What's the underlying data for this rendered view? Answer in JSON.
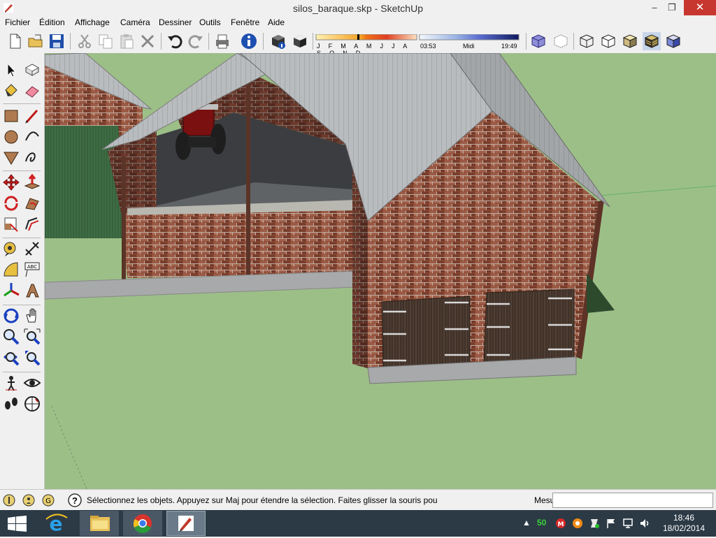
{
  "window": {
    "title": "silos_baraque.skp - SketchUp",
    "min_glyph": "–",
    "max_glyph": "❐",
    "close_glyph": "✕"
  },
  "menu": [
    "Fichier",
    "Édition",
    "Affichage",
    "Caméra",
    "Dessiner",
    "Outils",
    "Fenêtre",
    "Aide"
  ],
  "shadows": {
    "months": "J F M A M J J A S O N D",
    "time_start": "03:53",
    "time_mid": "Midi",
    "time_end": "19:49"
  },
  "status": {
    "message": "Sélectionnez les objets. Appuyez sur Maj pour étendre la sélection. Faites glisser la souris pou",
    "measures_label": "Mesures",
    "measures_value": "",
    "help_glyph": "?"
  },
  "taskbar": {
    "tray_count": "50",
    "time": "18:46",
    "date": "18/02/2014"
  },
  "colors": {
    "ground": "#9cbf88",
    "brick": "#8a4a36",
    "roof": "#b9bcbf",
    "door": "#4a3a30",
    "close_red": "#c7372f",
    "taskbar": "#2c3a46"
  },
  "icons": {
    "toolbar": [
      "new-icon",
      "open-icon",
      "save-icon",
      "cut-icon",
      "copy-icon",
      "paste-icon",
      "erase-icon",
      "undo-icon",
      "redo-icon",
      "print-icon",
      "model-info-icon",
      "shadow-settings-icon",
      "shadow-toggle-icon",
      "xray-icon",
      "wireframe-icon",
      "hidden-line-icon",
      "shaded-icon",
      "shaded-texture-icon",
      "monochrome-icon"
    ],
    "tools": [
      "select-icon",
      "make-component-icon",
      "paint-bucket-icon",
      "eraser-icon",
      "rectangle-icon",
      "line-icon",
      "circle-icon",
      "arc-icon",
      "polygon-icon",
      "freehand-icon",
      "move-icon",
      "push-pull-icon",
      "rotate-icon",
      "follow-me-icon",
      "scale-icon",
      "offset-icon",
      "tape-measure-icon",
      "dimension-icon",
      "protractor-icon",
      "text-icon",
      "axes-icon",
      "3d-text-icon",
      "orbit-icon",
      "pan-icon",
      "zoom-icon",
      "zoom-window-icon",
      "zoom-extents-icon",
      "previous-view-icon",
      "position-camera-icon",
      "look-around-icon",
      "walk-icon",
      "section-plane-icon"
    ]
  }
}
